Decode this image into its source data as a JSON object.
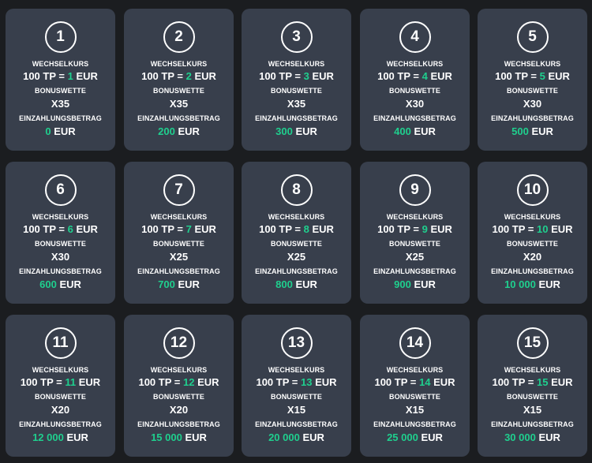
{
  "accent_color": "#1fcf8e",
  "card_bg_color": "#383f4c",
  "page_bg_color": "#1b1d20",
  "labels": {
    "exchange_rate": "WECHSELKURS",
    "bonus_wager": "BONUSWETTE",
    "deposit_amount": "EINZAHLUNGSBETRAG",
    "rate_prefix": "100 TP = ",
    "currency": "EUR"
  },
  "levels": [
    {
      "number": "1",
      "rate_value": "1",
      "wager": "X35",
      "deposit": "0"
    },
    {
      "number": "2",
      "rate_value": "2",
      "wager": "X35",
      "deposit": "200"
    },
    {
      "number": "3",
      "rate_value": "3",
      "wager": "X35",
      "deposit": "300"
    },
    {
      "number": "4",
      "rate_value": "4",
      "wager": "X30",
      "deposit": "400"
    },
    {
      "number": "5",
      "rate_value": "5",
      "wager": "X30",
      "deposit": "500"
    },
    {
      "number": "6",
      "rate_value": "6",
      "wager": "X30",
      "deposit": "600"
    },
    {
      "number": "7",
      "rate_value": "7",
      "wager": "X25",
      "deposit": "700"
    },
    {
      "number": "8",
      "rate_value": "8",
      "wager": "X25",
      "deposit": "800"
    },
    {
      "number": "9",
      "rate_value": "9",
      "wager": "X25",
      "deposit": "900"
    },
    {
      "number": "10",
      "rate_value": "10",
      "wager": "X20",
      "deposit": "10 000"
    },
    {
      "number": "11",
      "rate_value": "11",
      "wager": "X20",
      "deposit": "12 000"
    },
    {
      "number": "12",
      "rate_value": "12",
      "wager": "X20",
      "deposit": "15 000"
    },
    {
      "number": "13",
      "rate_value": "13",
      "wager": "X15",
      "deposit": "20 000"
    },
    {
      "number": "14",
      "rate_value": "14",
      "wager": "X15",
      "deposit": "25 000"
    },
    {
      "number": "15",
      "rate_value": "15",
      "wager": "X15",
      "deposit": "30 000"
    }
  ]
}
